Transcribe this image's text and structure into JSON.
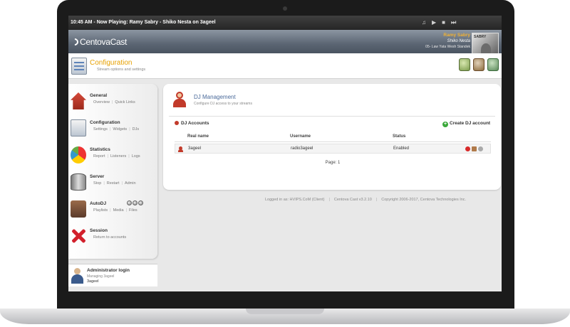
{
  "now_playing": {
    "text": "10:45 AM - Now Playing: Ramy Sabry - Shiko Nesta on 3ageel",
    "controls": [
      "♫",
      "▶",
      "■",
      "⏭"
    ]
  },
  "brand": {
    "logo_text": "CentovaCast"
  },
  "track": {
    "artist": "Ramy Sabry",
    "title": "Shiko Nesta",
    "album": "05- Law Yata Wesh Standek",
    "art_label": "SABRY"
  },
  "header": {
    "title": "Configuration",
    "subtitle": "Stream options and settings"
  },
  "sidebar": {
    "items": [
      {
        "title": "General",
        "links": [
          "Overview",
          "Quick Links"
        ]
      },
      {
        "title": "Configuration",
        "links": [
          "Settings",
          "Widgets",
          "DJs"
        ]
      },
      {
        "title": "Statistics",
        "links": [
          "Report",
          "Listeners",
          "Logs"
        ]
      },
      {
        "title": "Server",
        "links": [
          "Stop",
          "Restart",
          "Admin"
        ]
      },
      {
        "title": "AutoDJ",
        "links": [
          "Playlists",
          "Media",
          "Files"
        ]
      },
      {
        "title": "Session",
        "links": [
          "Return to accounts"
        ]
      }
    ]
  },
  "admin": {
    "title": "Administrator login",
    "subtitle": "Managing 3ageel",
    "username": "3ageel"
  },
  "dj": {
    "title": "DJ Management",
    "subtitle": "Configure DJ access to your streams",
    "accounts_label": "DJ Accounts",
    "create_label": "Create DJ account",
    "columns": [
      "Real name",
      "Username",
      "Status"
    ],
    "rows": [
      {
        "real_name": "3ageel",
        "username": "radio3ageel",
        "status": "Enabled"
      }
    ],
    "pager": "Page: 1"
  },
  "footer": {
    "logged_in": "Logged in as: HVIPS.CoM (Client)",
    "version": "Centova Cast v3.2.10",
    "copyright": "Copyright 2006-2017, Centova Technologies Inc."
  },
  "colors": {
    "accent_orange": "#e6a000",
    "title_blue": "#4a6a9a",
    "artist_gold": "#f2b233"
  }
}
